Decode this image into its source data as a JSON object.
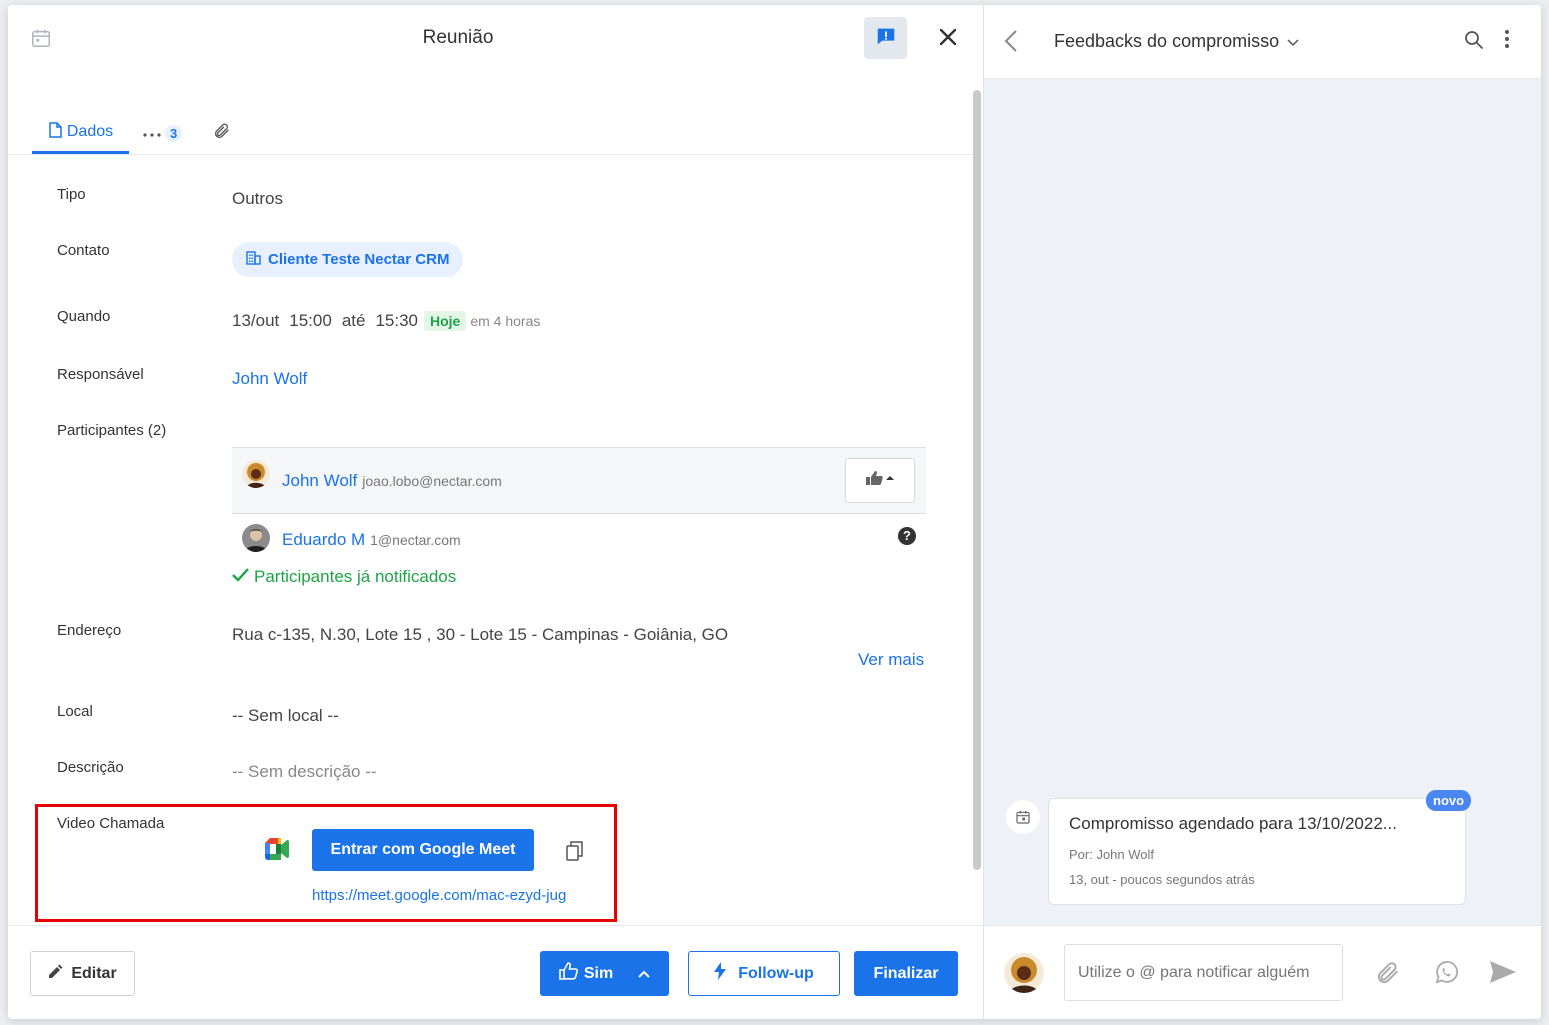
{
  "modal": {
    "title": "Reunião",
    "tabs": [
      {
        "label": "Dados"
      },
      {
        "label": "3"
      }
    ],
    "fields": {
      "tipo_label": "Tipo",
      "tipo_value": "Outros",
      "contato_label": "Contato",
      "contato_value": "Cliente Teste Nectar CRM",
      "quando_label": "Quando",
      "quando_date": "13/out",
      "quando_start": "15:00",
      "quando_ate": "até",
      "quando_end": "15:30",
      "quando_badge": "Hoje",
      "quando_relative": "em 4 horas",
      "responsavel_label": "Responsável",
      "responsavel_value": "John Wolf",
      "participantes_label": "Participantes (2)",
      "endereco_label": "Endereço",
      "endereco_value": "Rua c-135, N.30, Lote 15 , 30 - Lote 15 - Campinas - Goiânia, GO",
      "ver_mais": "Ver mais",
      "local_label": "Local",
      "local_value": "-- Sem local --",
      "descricao_label": "Descrição",
      "descricao_value": "-- Sem descrição --",
      "video_label": "Video Chamada",
      "meet_button": "Entrar com Google Meet",
      "meet_link": "https://meet.google.com/mac-ezyd-jug"
    },
    "participants": [
      {
        "name": "John Wolf",
        "email": "joao.lobo@nectar.com"
      },
      {
        "name": "Eduardo M",
        "email": "1@nectar.com"
      }
    ],
    "notified": "Participantes já notificados",
    "footer": {
      "edit": "Editar",
      "sim": "Sim",
      "followup": "Follow-up",
      "finalizar": "Finalizar"
    }
  },
  "feedback_panel": {
    "title": "Feedbacks do compromisso",
    "card": {
      "title": "Compromisso agendado para 13/10/2022...",
      "by": "Por: John Wolf",
      "time": "13, out - poucos segundos atrás",
      "badge": "novo"
    },
    "input_placeholder": "Utilize o @ para notificar alguém"
  },
  "colors": {
    "primary": "#1a73e8",
    "success": "#1ea446",
    "highlight_border": "#e60000"
  }
}
